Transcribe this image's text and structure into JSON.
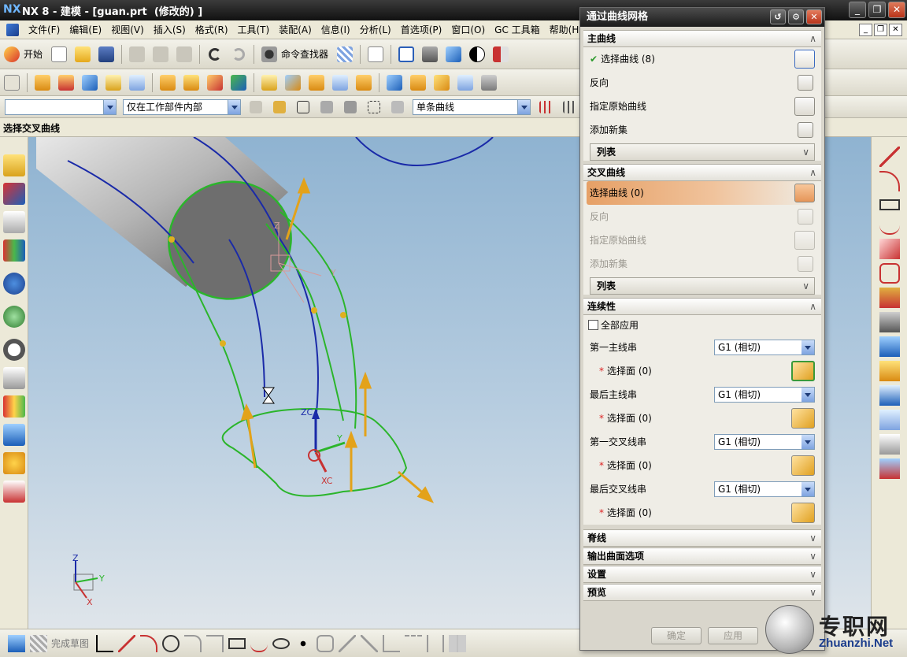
{
  "window": {
    "app_logo": "NX",
    "title": "NX 8 - 建模 - [guan.prt  (修改的) ]",
    "min_glyph": "_",
    "restore_glyph": "❐",
    "close_glyph": "✕"
  },
  "menu": {
    "items": [
      "文件(F)",
      "编辑(E)",
      "视图(V)",
      "插入(S)",
      "格式(R)",
      "工具(T)",
      "装配(A)",
      "信息(I)",
      "分析(L)",
      "首选项(P)",
      "窗口(O)",
      "GC 工具箱",
      "帮助(H)"
    ],
    "mdi_min": "_",
    "mdi_restore": "❐",
    "mdi_close": "✕"
  },
  "toolbar": {
    "start_label": "开始",
    "command_finder_label": "命令查找器",
    "filter_combo_value": "",
    "scope_combo_value": "仅在工作部件内部",
    "curve_rule_value": "单条曲线"
  },
  "cue_line": {
    "text": "选择交叉曲线"
  },
  "viewport": {
    "labels": {
      "zc": "ZC",
      "xc": "XC",
      "yc": "Y",
      "wcs_z": "Z",
      "wcs_y": "Y",
      "triad_z": "Z",
      "triad_y": "Y",
      "triad_x": "X"
    },
    "colors": {
      "green_curve": "#2bb52b",
      "blue_curve": "#1a2aa8",
      "vector": "#e3a21a",
      "body": "#6e6e6e"
    }
  },
  "bottom_toolbar": {
    "finish_sketch_label": "完成草图"
  },
  "dialog": {
    "title": "通过曲线网格",
    "primary": {
      "header": "主曲线",
      "select_curve": "选择曲线 (8)",
      "reverse": "反向",
      "specify_origin": "指定原始曲线",
      "add_new_set": "添加新集",
      "list": "列表"
    },
    "cross": {
      "header": "交叉曲线",
      "select_curve": "选择曲线 (0)",
      "reverse": "反向",
      "specify_origin": "指定原始曲线",
      "add_new_set": "添加新集",
      "list": "列表"
    },
    "continuity": {
      "header": "连续性",
      "apply_all": "全部应用",
      "first_primary": "第一主线串",
      "first_primary_value": "G1 (相切)",
      "first_primary_face": "选择面 (0)",
      "last_primary": "最后主线串",
      "last_primary_value": "G1 (相切)",
      "last_primary_face": "选择面 (0)",
      "first_cross": "第一交叉线串",
      "first_cross_value": "G1 (相切)",
      "first_cross_face": "选择面 (0)",
      "last_cross": "最后交叉线串",
      "last_cross_value": "G1 (相切)",
      "last_cross_face": "选择面 (0)"
    },
    "collapsed_sections": [
      "脊线",
      "输出曲面选项",
      "设置",
      "预览"
    ],
    "ok_label": "确定",
    "apply_label": "应用",
    "expand_glyph": "∧",
    "collapse_glyph": "∨",
    "check_glyph": "✔",
    "star_glyph": "*"
  },
  "watermark": {
    "name": "专职网",
    "url": "Zhuanzhi.Net"
  }
}
